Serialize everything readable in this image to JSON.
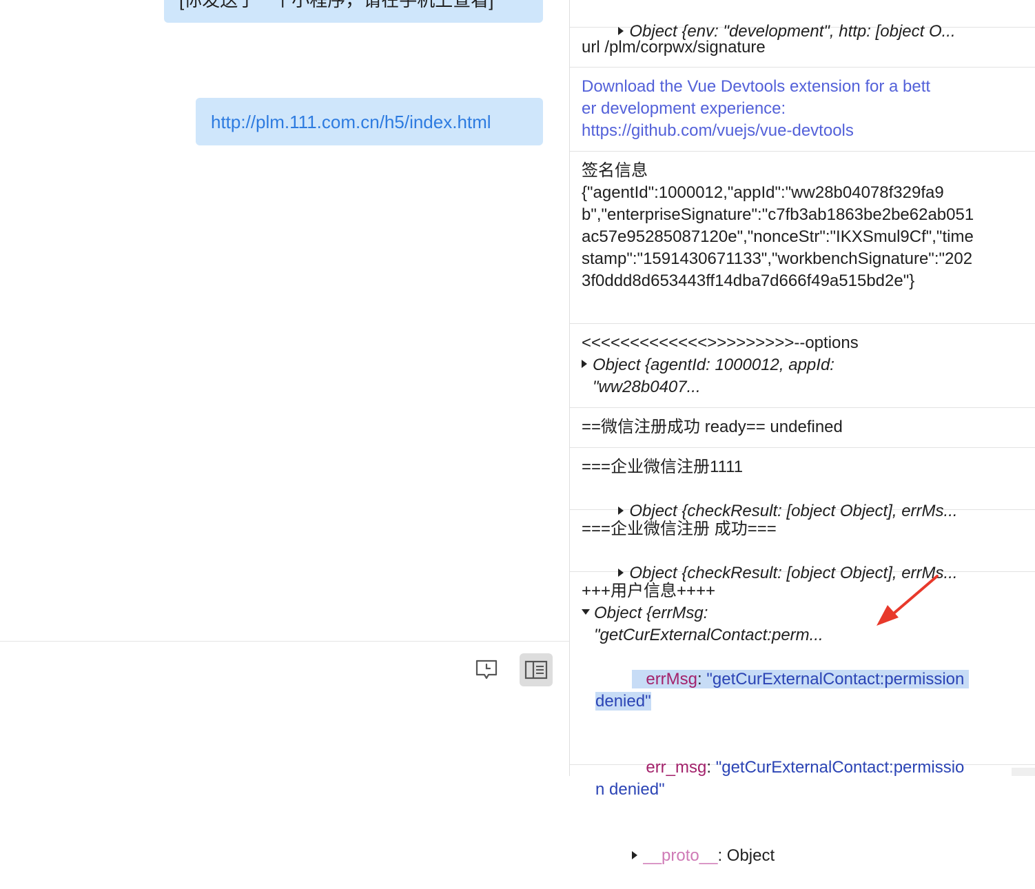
{
  "chat": {
    "top_bubble": "[你发送了一个小程序，请在手机上查看]",
    "link_bubble": "http://plm.111.com.cn/h5/index.html"
  },
  "toolbar": {
    "history_icon": "chat-history-icon",
    "panel_icon": "side-panel-icon"
  },
  "console": {
    "rows": [
      {
        "object": "Object {env: \"development\", http: [object O..."
      },
      {
        "text": "url /plm/corpwx/signature"
      },
      {
        "link_text": "Download the Vue Devtools extension for a better development experience:\nhttps://github.com/vuejs/vue-devtools"
      },
      {
        "text": "签名信息\n{\"agentId\":1000012,\"appId\":\"ww28b04078f329fa9b\",\"enterpriseSignature\":\"c7fb3ab1863be2be62ab051ac57e95285087120e\",\"nonceStr\":\"IKXSmul9Cf\",\"timestamp\":\"1591430671133\",\"workbenchSignature\":\"2023f0ddd8d653443ff14dba7d666f49a515bd2e\"}"
      },
      {
        "text": "<<<<<<<<<<<<<>>>>>>>>>--options",
        "object": "Object {agentId: 1000012, appId:\n\"ww28b0407..."
      },
      {
        "text": "==微信注册成功 ready== undefined"
      },
      {
        "text": "===企业微信注册1111",
        "object": "Object {checkResult: [object Object], errMs..."
      },
      {
        "text": "===企业微信注册 成功===",
        "object": "Object {checkResult: [object Object], errMs..."
      },
      {
        "text": "+++用户信息++++",
        "object": "Object {errMsg:\n\"getCurExternalContact:perm...",
        "props": [
          {
            "key": "errMsg",
            "value": "\"getCurExternalContact:permission denied\""
          },
          {
            "key": "err_msg",
            "value": "\"getCurExternalContact:permission denied\""
          }
        ],
        "proto_key": "__proto__",
        "proto_value": ": Object"
      }
    ]
  },
  "colors": {
    "bubble_bg": "#cfe6fb",
    "link": "#5361d9",
    "prop_key": "#a3226b",
    "prop_string": "#2b44b5",
    "highlight": "#c7dcf6",
    "arrow": "#e8392b"
  }
}
